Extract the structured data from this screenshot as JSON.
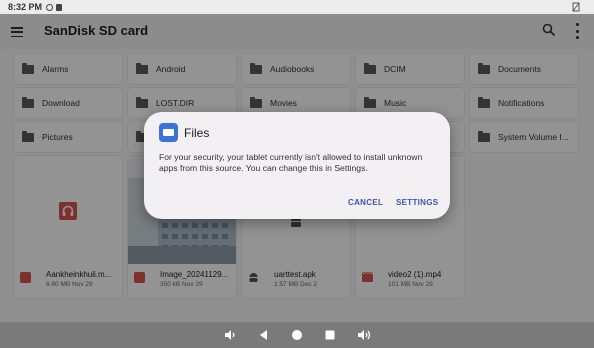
{
  "status_bar": {
    "time": "8:32 PM"
  },
  "toolbar": {
    "title": "SanDisk SD card"
  },
  "folders": [
    {
      "name": "Alarms"
    },
    {
      "name": "Android"
    },
    {
      "name": "Audiobooks"
    },
    {
      "name": "DCIM"
    },
    {
      "name": "Documents"
    },
    {
      "name": "Download"
    },
    {
      "name": "LOST.DIR"
    },
    {
      "name": "Movies"
    },
    {
      "name": "Music"
    },
    {
      "name": "Notifications"
    },
    {
      "name": "Pictures"
    },
    {
      "name": ""
    },
    {
      "name": ""
    },
    {
      "name": ""
    },
    {
      "name": "System Volume I..."
    }
  ],
  "files": [
    {
      "name": "Aankheinkhuli.m...",
      "info": "6.80 MB Nov 29",
      "icon": "audio-file-icon",
      "color": "#d9534f"
    },
    {
      "name": "Image_20241129...",
      "info": "350 kB Nov 29",
      "icon": "image-file-icon",
      "color": "#d9534f"
    },
    {
      "name": "uarttest.apk",
      "info": "1.57 MB Dec 2",
      "icon": "android-icon",
      "color": "#555555"
    },
    {
      "name": "video2 (1).mp4",
      "info": "101 MB Nov 29",
      "icon": "video-file-icon",
      "color": "#d9534f"
    }
  ],
  "dialog": {
    "title": "Files",
    "message": "For your security, your tablet currently isn't allowed to install unknown apps from this source. You can change this in Settings.",
    "cancel_label": "CANCEL",
    "settings_label": "SETTINGS"
  },
  "colors": {
    "accent": "#3c55b0",
    "files_icon": "#3b73d8"
  }
}
